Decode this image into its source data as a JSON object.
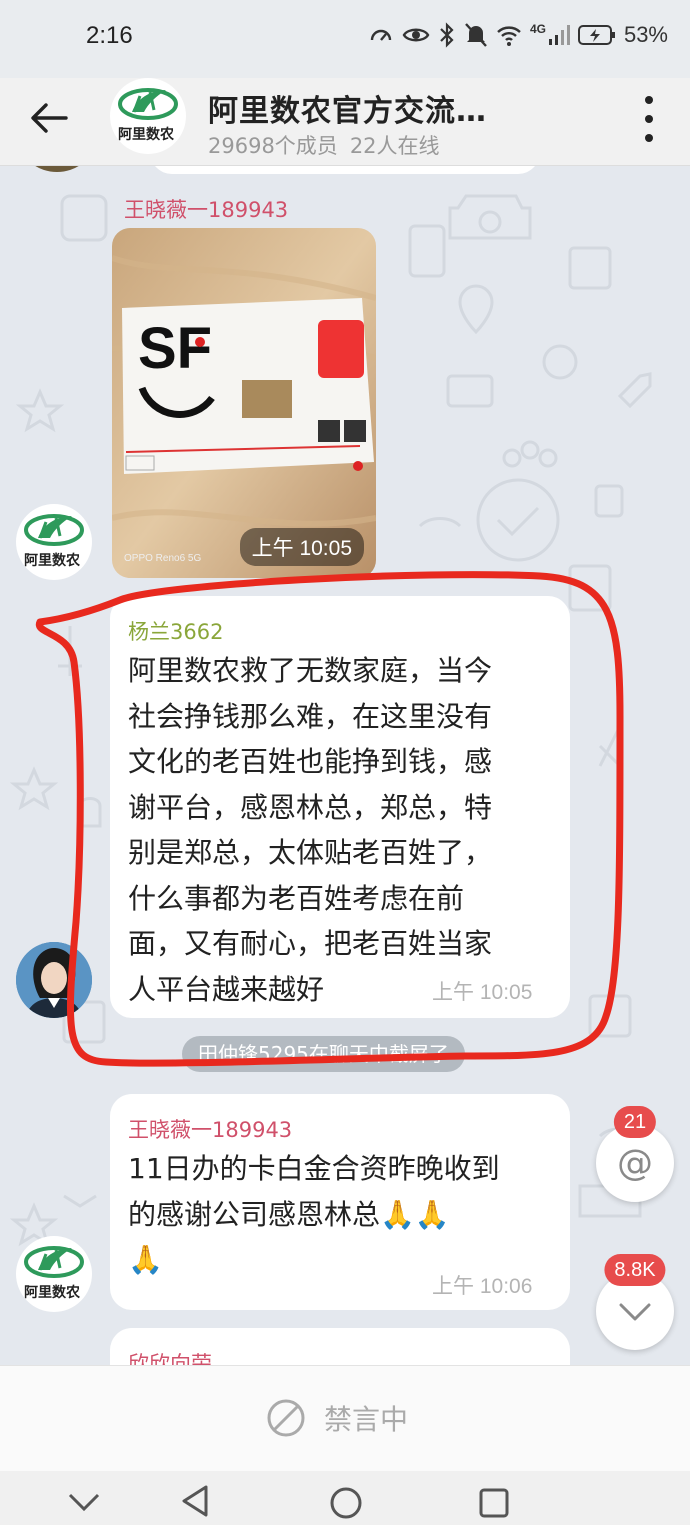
{
  "status_bar": {
    "time": "2:16",
    "network": "4G",
    "battery": "53%"
  },
  "header": {
    "title": "阿里数农官方交流…",
    "member_count": "29698个成员",
    "online_count": "22人在线",
    "avatar_text": "阿里数农"
  },
  "messages": [
    {
      "sender": "王晓薇一189943",
      "type": "image",
      "image_caption": "OPPO Reno6 5G",
      "time": "上午 10:05",
      "avatar_text": "阿里数农"
    },
    {
      "sender": "杨兰3662",
      "type": "text",
      "lines": [
        "阿里数农救了无数家庭，当今",
        "社会挣钱那么难，在这里没有",
        "文化的老百姓也能挣到钱，感",
        "谢平台，感恩林总，郑总，特",
        "别是郑总，太体贴老百姓了，",
        "什么事都为老百姓考虑在前",
        "面，又有耐心，把老百姓当家",
        "人平台越来越好"
      ],
      "time": "上午 10:05"
    },
    {
      "type": "system",
      "text": "田仲锋5295在聊天中截屏了"
    },
    {
      "sender": "王晓薇一189943",
      "type": "text",
      "lines": [
        "11日办的卡白金合资昨晚收到",
        "的感谢公司感恩林总🙏🙏",
        "🙏"
      ],
      "time": "上午 10:06",
      "avatar_text": "阿里数农"
    },
    {
      "sender": "欣欣向荣",
      "type": "text"
    }
  ],
  "fabs": {
    "mention_count": "21",
    "mention_symbol": "@",
    "unread_count": "8.8K"
  },
  "input": {
    "muted_label": "禁言中"
  },
  "colors": {
    "sender_pink": "#d0506a",
    "sender_green": "#8aa63a",
    "badge_red": "#e74c4c",
    "logo_green": "#2e9a5b",
    "annotation_red": "#e8291e"
  }
}
